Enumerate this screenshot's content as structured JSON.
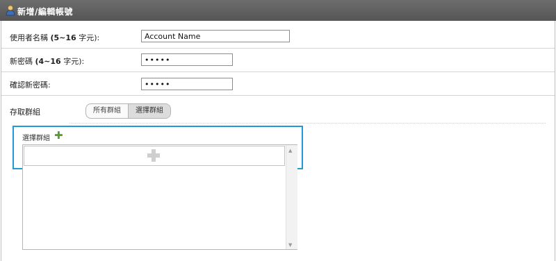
{
  "header": {
    "title": "新增/編輯帳號",
    "icon": "user-icon"
  },
  "form": {
    "username": {
      "label_text": "使用者名稱 ",
      "label_bold": "(5~16",
      "label_unit": " 字元):",
      "value": "Account Name"
    },
    "new_password": {
      "label_text": "新密碼 ",
      "label_bold": "(4~16",
      "label_unit": " 字元):",
      "value": "•••••"
    },
    "confirm_password": {
      "label": "確認新密碼:",
      "value": "•••••"
    }
  },
  "access": {
    "label": "存取群組",
    "options": [
      "所有群組",
      "選擇群組"
    ],
    "selected": "選擇群組"
  },
  "group_panel": {
    "label": "選擇群組",
    "add_icon": "plus-icon",
    "add_symbol": "✚"
  },
  "colors": {
    "accent": "#1e9ad6",
    "add_green": "#55a02c",
    "header_bg": "#5e5e5e"
  }
}
